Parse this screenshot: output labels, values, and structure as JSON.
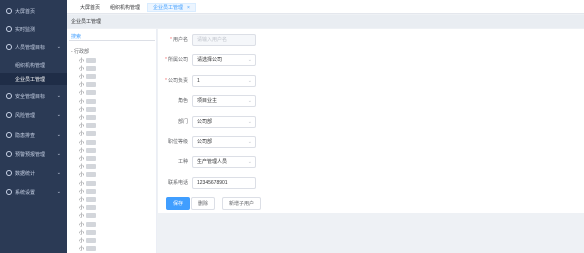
{
  "sidebar": {
    "items": [
      {
        "label": "大屏首页",
        "icon": "home-icon"
      },
      {
        "label": "实时监测",
        "icon": "monitor-icon"
      },
      {
        "label": "人员管理目标",
        "icon": "user-icon"
      },
      {
        "label": "安全管理目标",
        "icon": "shield-icon"
      },
      {
        "label": "风险管理",
        "icon": "warning-icon"
      },
      {
        "label": "隐患排查",
        "icon": "search-icon"
      },
      {
        "label": "预警预报管理",
        "icon": "bell-icon"
      },
      {
        "label": "数据统计",
        "icon": "chart-icon"
      },
      {
        "label": "系统设置",
        "icon": "gear-icon"
      }
    ],
    "sub_items": [
      {
        "label": "组织机构管理",
        "active": false
      },
      {
        "label": "企业员工管理",
        "active": true
      }
    ]
  },
  "tabs": [
    {
      "label": "大屏首页",
      "active": false
    },
    {
      "label": "组织机构管理",
      "active": false
    },
    {
      "label": "企业员工管理",
      "active": true,
      "close": "×"
    }
  ],
  "breadcrumb": "企业员工管理",
  "tree": {
    "search_placeholder": "搜索",
    "root_label": "- 行政部",
    "item_prefix": "小",
    "item_count": 24
  },
  "form": {
    "fields": [
      {
        "label": "用户名",
        "required": true,
        "value": "请输入用户名",
        "disabled": true,
        "select": false
      },
      {
        "label": "所属公司",
        "required": true,
        "value": "请选择公司",
        "disabled": false,
        "select": true
      },
      {
        "label": "公司负责",
        "required": true,
        "value": "1",
        "disabled": false,
        "select": true
      },
      {
        "label": "角色",
        "required": false,
        "value": "项目业主",
        "disabled": false,
        "select": true
      },
      {
        "label": "部门",
        "required": false,
        "value": "公司部",
        "disabled": false,
        "select": true
      },
      {
        "label": "职位等级",
        "required": false,
        "value": "公司部",
        "disabled": false,
        "select": true
      },
      {
        "label": "工种",
        "required": false,
        "value": "生产管理人员",
        "disabled": false,
        "select": true
      },
      {
        "label": "联系电话",
        "required": false,
        "value": "12345678901",
        "disabled": false,
        "select": false
      }
    ],
    "buttons": [
      {
        "label": "保存",
        "primary": true
      },
      {
        "label": "删除",
        "primary": false
      },
      {
        "label": "新增子用户",
        "primary": false
      }
    ]
  },
  "colors": {
    "accent": "#409eff",
    "sidebar": "#2b3a55"
  }
}
